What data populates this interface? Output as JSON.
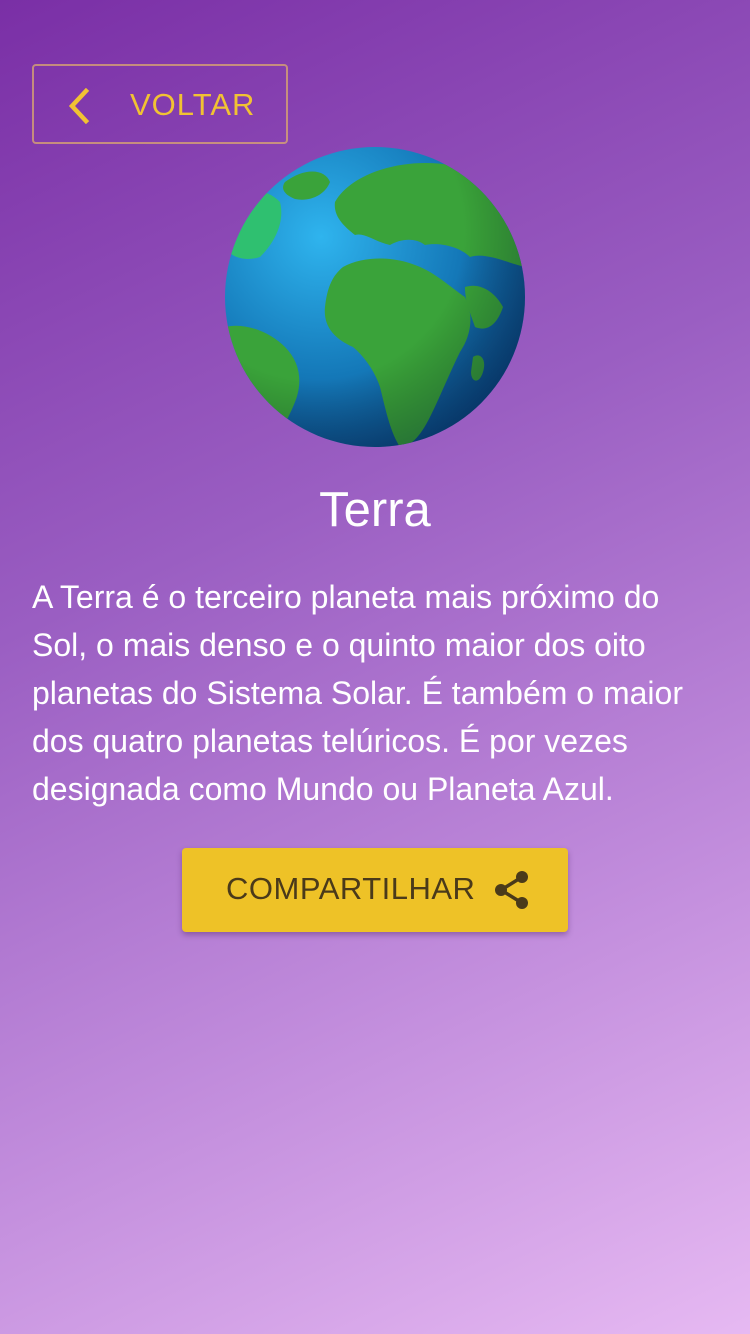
{
  "back_button": {
    "label": "VOLTAR",
    "icon": "chevron-left-icon",
    "color": "#f1c233"
  },
  "planet": {
    "name": "Terra",
    "image": "earth-globe-icon",
    "description": "A Terra é o terceiro planeta mais próximo do Sol, o mais denso e o quinto maior dos oito planetas do Sistema Solar. É também o maior dos quatro planetas telúricos. É por vezes designada como Mundo ou Planeta Azul."
  },
  "share_button": {
    "label": "COMPARTILHAR",
    "icon": "share-icon",
    "background": "#eec227"
  },
  "colors": {
    "gradient_start": "#7a2fa6",
    "gradient_end": "#e6b9f2",
    "text": "#ffffff"
  }
}
